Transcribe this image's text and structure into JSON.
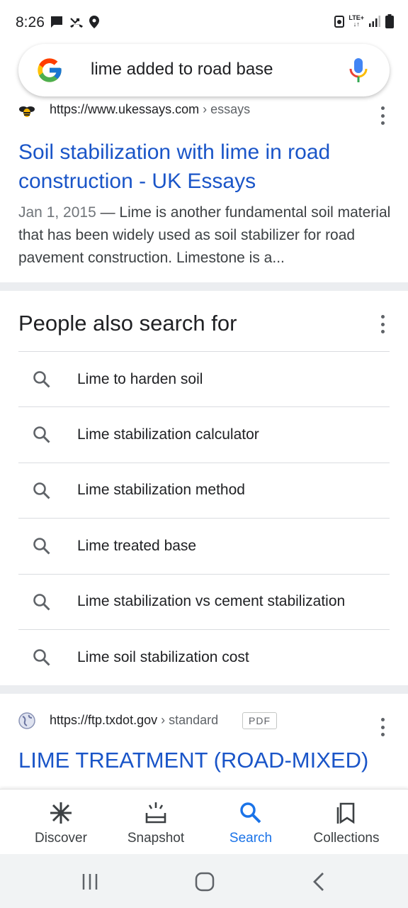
{
  "status_bar": {
    "time": "8:26",
    "network": "LTE+"
  },
  "search": {
    "query": "lime added to road base"
  },
  "result1": {
    "url_domain": "https://www.ukessays.com",
    "url_crumb": " › essays",
    "title": "Soil stabilization with lime in road construction - UK Essays",
    "date": "Jan 1, 2015",
    "snippet": " — Lime is another fundamental soil material that has been widely used as soil stabilizer for road pavement construction. Limestone is a..."
  },
  "people_also_search": {
    "title": "People also search for",
    "items": [
      "Lime to harden soil",
      "Lime stabilization calculator",
      "Lime stabilization method",
      "Lime treated base",
      "Lime stabilization vs cement stabilization",
      "Lime soil stabilization cost"
    ]
  },
  "result2": {
    "url_domain": "https://ftp.txdot.gov",
    "url_crumb": " › standard",
    "badge": "PDF",
    "title": "LIME TREATMENT (ROAD-MIXED)"
  },
  "bottom_nav": {
    "items": [
      "Discover",
      "Snapshot",
      "Search",
      "Collections"
    ],
    "active": "Search"
  },
  "colors": {
    "link_blue": "#1a55c8",
    "active_blue": "#1a73e8",
    "divider_band": "#ebedf0"
  }
}
